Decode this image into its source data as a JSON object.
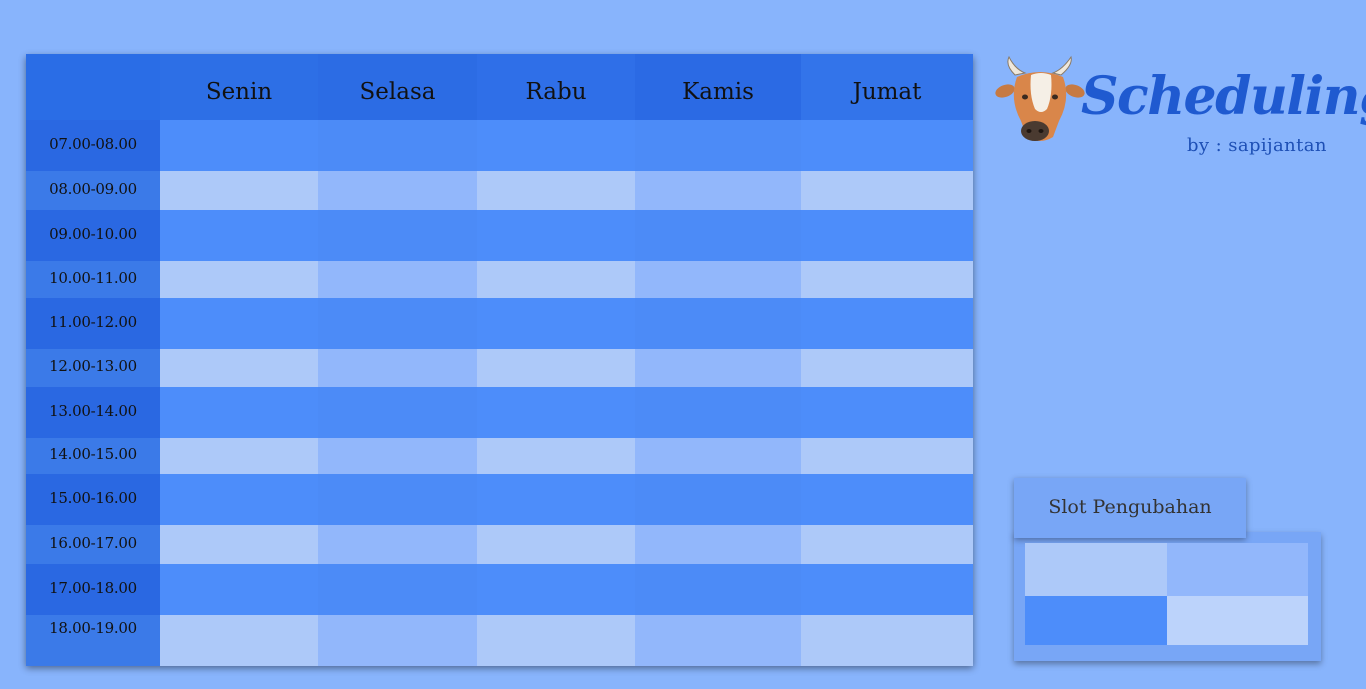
{
  "schedule": {
    "days": [
      "Senin",
      "Selasa",
      "Rabu",
      "Kamis",
      "Jumat"
    ],
    "times": [
      "07.00-08.00",
      "08.00-09.00",
      "09.00-10.00",
      "10.00-11.00",
      "11.00-12.00",
      "12.00-13.00",
      "13.00-14.00",
      "14.00-15.00",
      "15.00-16.00",
      "16.00-17.00",
      "17.00-18.00",
      "18.00-19.00"
    ]
  },
  "logo": {
    "title": "Scheduling",
    "subtitle": "by : sapijantan",
    "icon": "cow-head-icon"
  },
  "slot_panel": {
    "title": "Slot Pengubahan"
  },
  "colors": {
    "background": "#88b4fc",
    "header": "#2d6fe6",
    "slot_dark": "#4d8dfa",
    "slot_light": "#adc9f9",
    "slot_mid": "#92b7fb",
    "brand": "#1f5ad0"
  }
}
